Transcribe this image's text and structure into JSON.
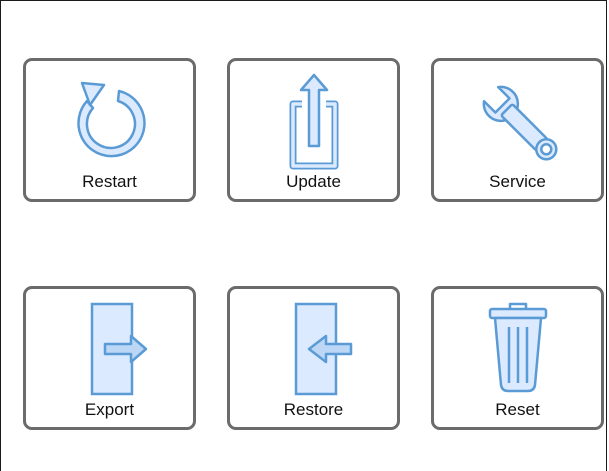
{
  "tiles": {
    "restart": {
      "label": "Restart",
      "icon": "restart-icon"
    },
    "update": {
      "label": "Update",
      "icon": "upload-icon"
    },
    "service": {
      "label": "Service",
      "icon": "wrench-icon"
    },
    "export": {
      "label": "Export",
      "icon": "export-icon"
    },
    "restore": {
      "label": "Restore",
      "icon": "import-icon"
    },
    "reset": {
      "label": "Reset",
      "icon": "trash-icon"
    }
  },
  "colors": {
    "icon_fill": "#dbeafe",
    "icon_stroke": "#5b9bd5",
    "tile_border": "#6b6b6b"
  }
}
